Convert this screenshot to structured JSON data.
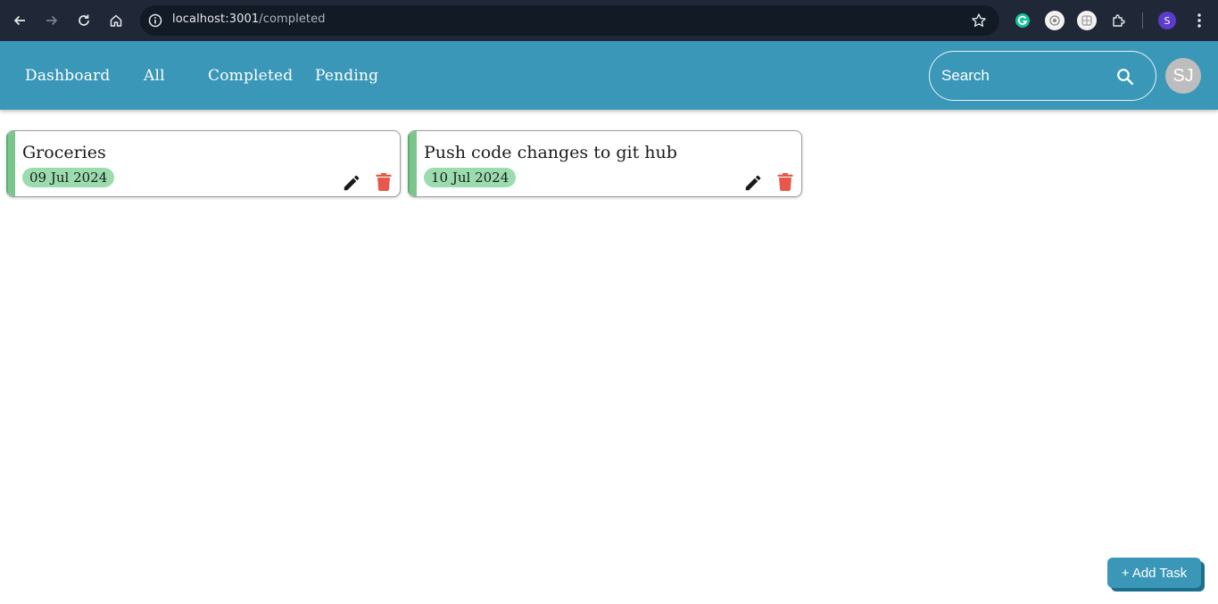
{
  "browser": {
    "url_host": "localhost:3001",
    "url_path": "/completed",
    "profile_initial": "S",
    "icons": [
      "back-icon",
      "forward-icon",
      "reload-icon",
      "home-icon",
      "site-info-icon",
      "bookmark-star-icon",
      "grammarly-extension-icon",
      "extension-icon",
      "extension-icon",
      "extensions-puzzle-icon",
      "more-menu-icon"
    ]
  },
  "header": {
    "nav": [
      "Dashboard",
      "All",
      "Completed",
      "Pending"
    ],
    "search": {
      "placeholder": "Search",
      "value": ""
    },
    "avatar_initials": "SJ"
  },
  "tasks": [
    {
      "title": "Groceries",
      "date": "09 Jul 2024"
    },
    {
      "title": "Push code changes to git hub",
      "date": "10 Jul 2024"
    }
  ],
  "add_task_label": "+ Add Task",
  "colors": {
    "header": "#3a97b8",
    "completed_stripe": "#7cc68e",
    "date_badge": "#9bdcae",
    "delete_icon": "#e8584a"
  }
}
